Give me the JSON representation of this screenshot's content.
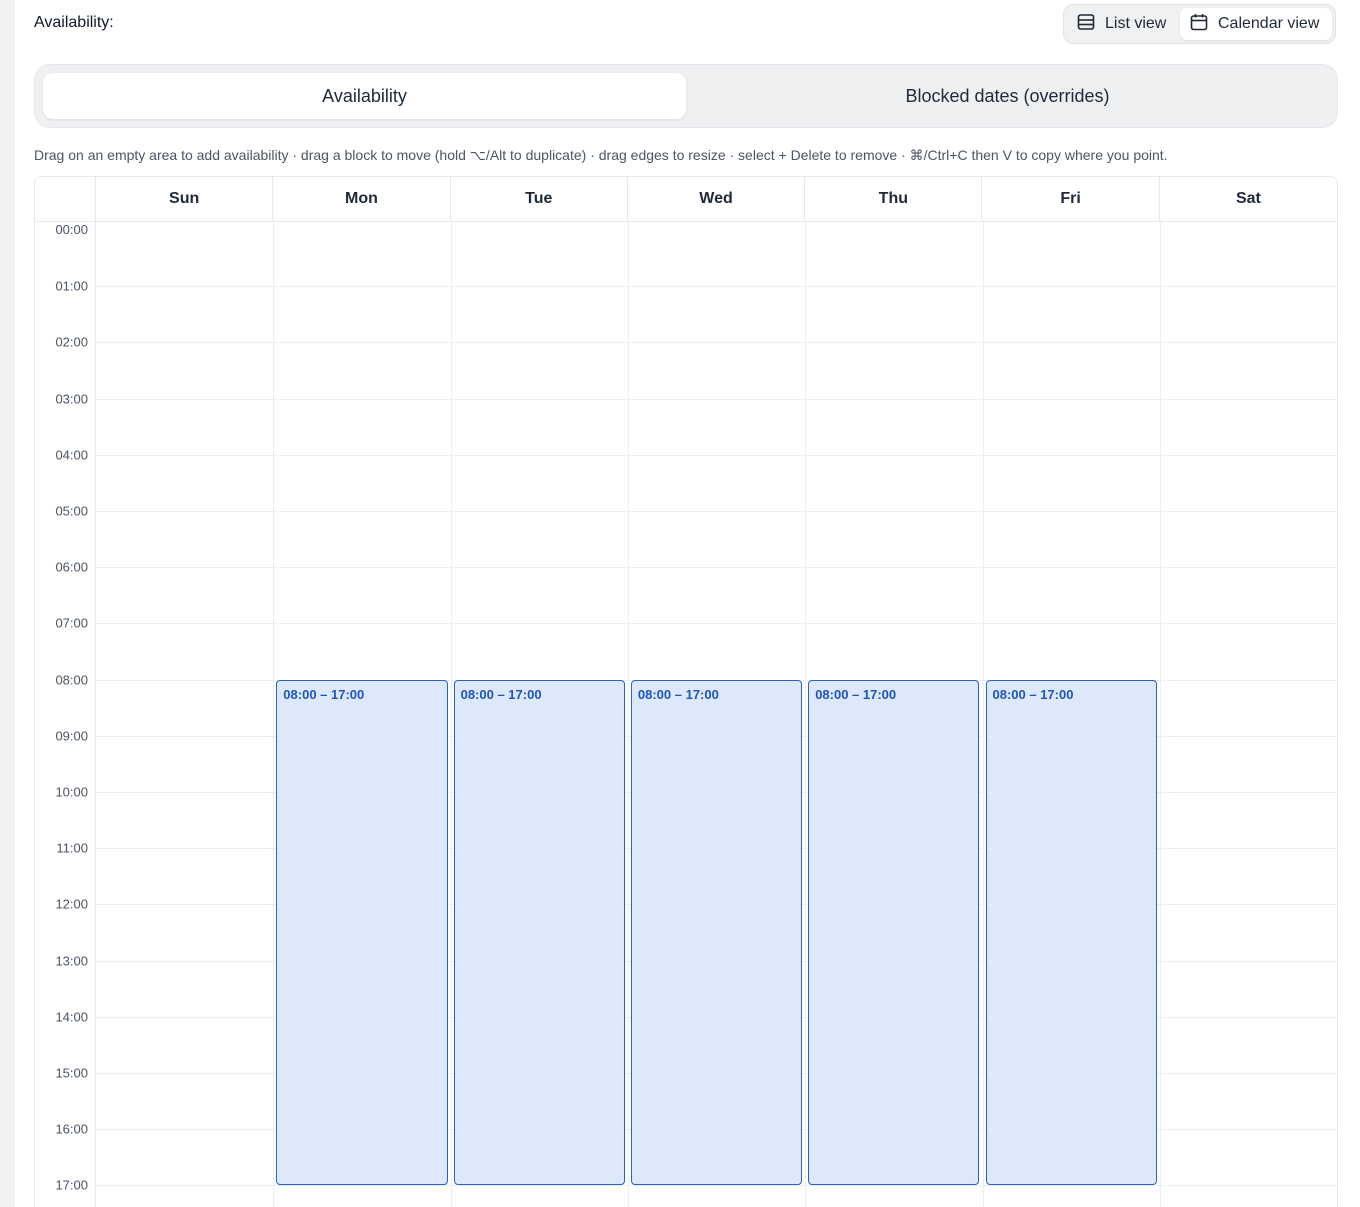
{
  "header": {
    "label": "Availability:"
  },
  "view_toggle": {
    "list_label": "List view",
    "calendar_label": "Calendar view",
    "active": "calendar"
  },
  "tabs": [
    {
      "label": "Availability",
      "active": true
    },
    {
      "label": "Blocked dates (overrides)",
      "active": false
    }
  ],
  "hint": "Drag on an empty area to add availability · drag a block to move (hold ⌥/Alt to duplicate) · drag edges to resize · select + Delete to remove · ⌘/Ctrl+C then V to copy where you point.",
  "calendar": {
    "days": [
      "Sun",
      "Mon",
      "Tue",
      "Wed",
      "Thu",
      "Fri",
      "Sat"
    ],
    "hours": [
      "00:00",
      "01:00",
      "02:00",
      "03:00",
      "04:00",
      "05:00",
      "06:00",
      "07:00",
      "08:00",
      "09:00",
      "10:00",
      "11:00",
      "12:00",
      "13:00",
      "14:00",
      "15:00",
      "16:00",
      "17:00"
    ],
    "blocks": [
      {
        "day": "Mon",
        "start": "08:00",
        "end": "17:00",
        "label": "08:00 – 17:00"
      },
      {
        "day": "Tue",
        "start": "08:00",
        "end": "17:00",
        "label": "08:00 – 17:00"
      },
      {
        "day": "Wed",
        "start": "08:00",
        "end": "17:00",
        "label": "08:00 – 17:00"
      },
      {
        "day": "Thu",
        "start": "08:00",
        "end": "17:00",
        "label": "08:00 – 17:00"
      },
      {
        "day": "Fri",
        "start": "08:00",
        "end": "17:00",
        "label": "08:00 – 17:00"
      }
    ]
  },
  "icons": {
    "list": "list-icon",
    "calendar": "calendar-icon"
  },
  "colors": {
    "block_fill": "#dde8fa",
    "block_border": "#2563c9",
    "block_text": "#1d55c0"
  }
}
